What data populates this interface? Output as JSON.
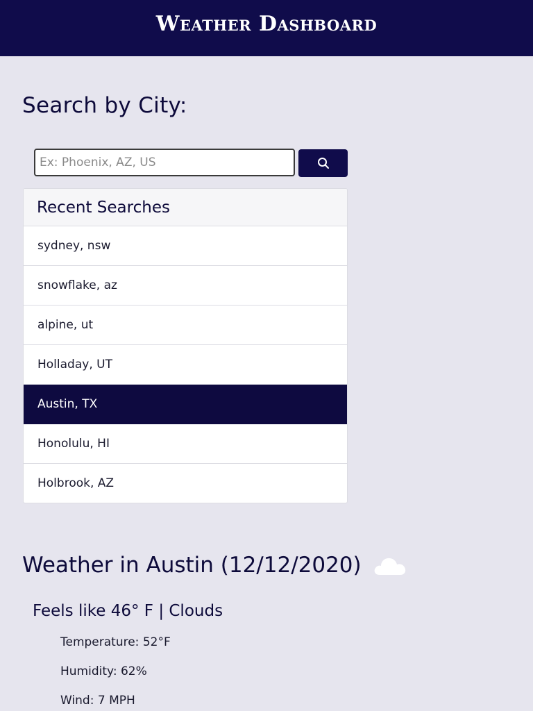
{
  "header": {
    "title": "Weather Dashboard"
  },
  "search": {
    "title": "Search by City:",
    "placeholder": "Ex: Phoenix, AZ, US",
    "value": "",
    "button_icon": "search-icon"
  },
  "recent": {
    "title": "Recent Searches",
    "items": [
      {
        "label": "sydney, nsw"
      },
      {
        "label": "snowflake, az"
      },
      {
        "label": "alpine, ut"
      },
      {
        "label": "Holladay, UT"
      },
      {
        "label": "Austin, TX"
      },
      {
        "label": "Honolulu, HI"
      },
      {
        "label": "Holbrook, AZ"
      }
    ],
    "selected_index": 4
  },
  "weather": {
    "title": "Weather in Austin (12/12/2020)",
    "icon": "cloud-icon",
    "summary": "Feels like 46° F | Clouds",
    "temperature": "Temperature: 52°F",
    "humidity": "Humidity: 62%",
    "wind": "Wind: 7 MPH"
  },
  "colors": {
    "header_bg": "#100c4b",
    "page_bg": "#e6e5ee",
    "active_item_bg": "#0e0a40",
    "text_dark": "#0d0a3a"
  }
}
